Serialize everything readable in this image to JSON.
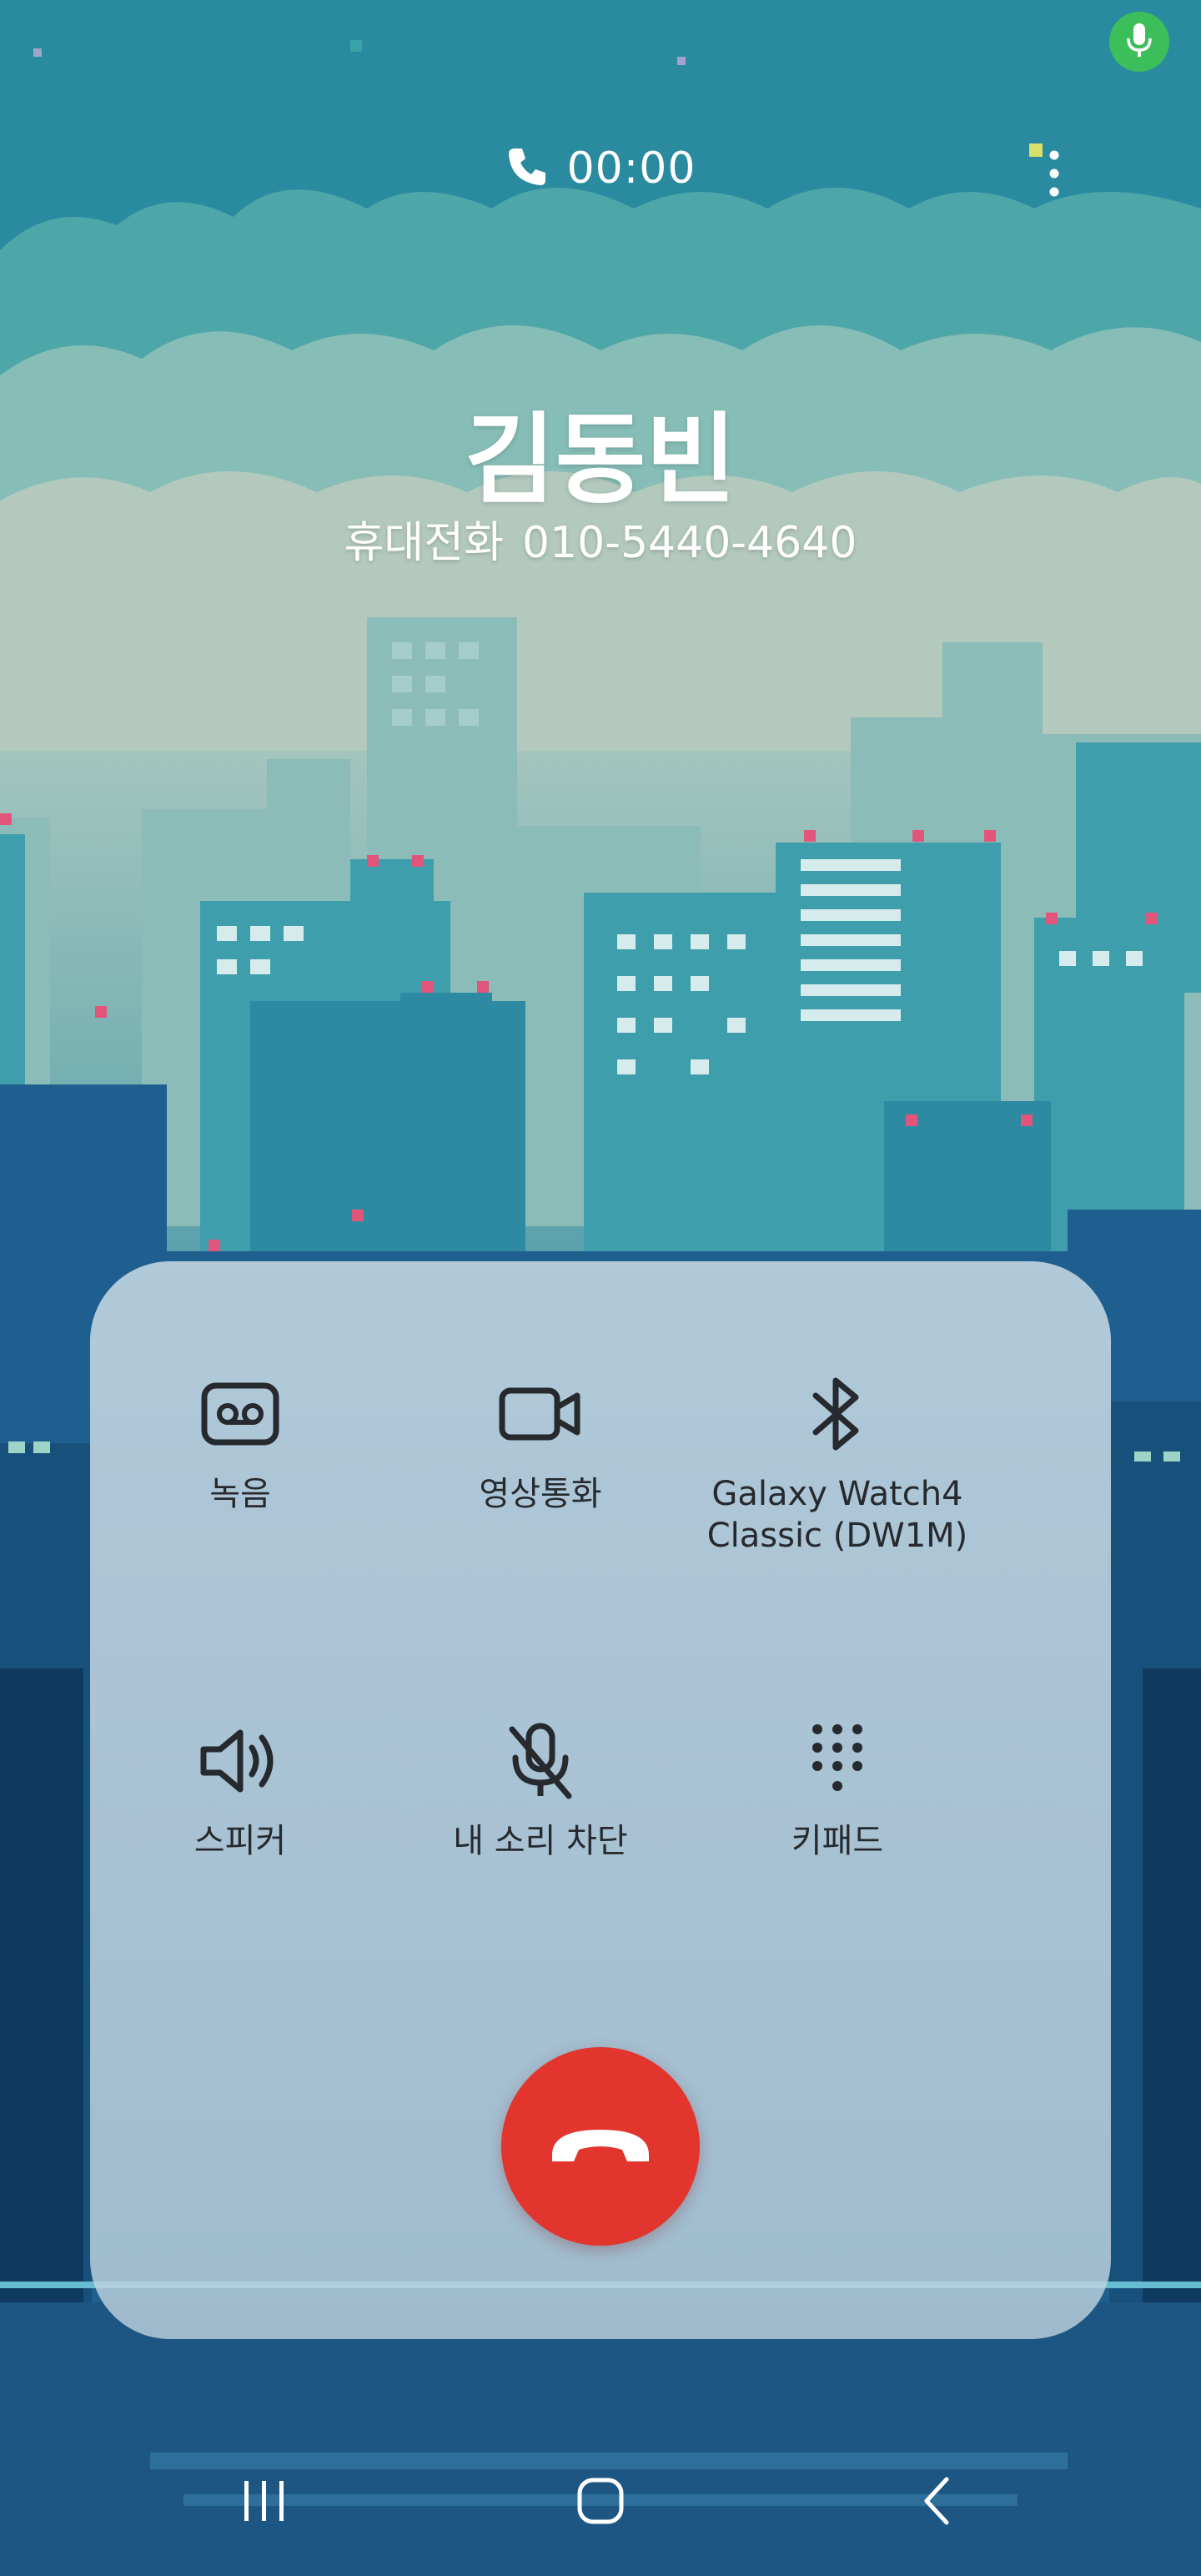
{
  "status": {
    "mic_icon": "mic-icon",
    "mic_color": "#3cbf5a"
  },
  "call": {
    "timer": "00:00",
    "caller_name": "김동빈",
    "number_type": "휴대전화",
    "number": "010-5440-4640"
  },
  "controls": [
    {
      "id": "record",
      "label": "녹음",
      "icon": "voicemail-icon"
    },
    {
      "id": "video",
      "label": "영상통화",
      "icon": "video-camera-icon"
    },
    {
      "id": "bluetooth",
      "label": "Galaxy Watch4 Classic (DW1M)",
      "icon": "bluetooth-icon"
    },
    {
      "id": "speaker",
      "label": "스피커",
      "icon": "speaker-icon"
    },
    {
      "id": "mute",
      "label": "내 소리 차단",
      "icon": "mic-off-icon"
    },
    {
      "id": "keypad",
      "label": "키패드",
      "icon": "keypad-icon"
    }
  ],
  "end_call": {
    "icon": "end-call-icon",
    "color": "#e2352d"
  },
  "navigation": {
    "recents_icon": "recent-apps-icon",
    "home_icon": "home-icon",
    "back_icon": "back-icon"
  }
}
